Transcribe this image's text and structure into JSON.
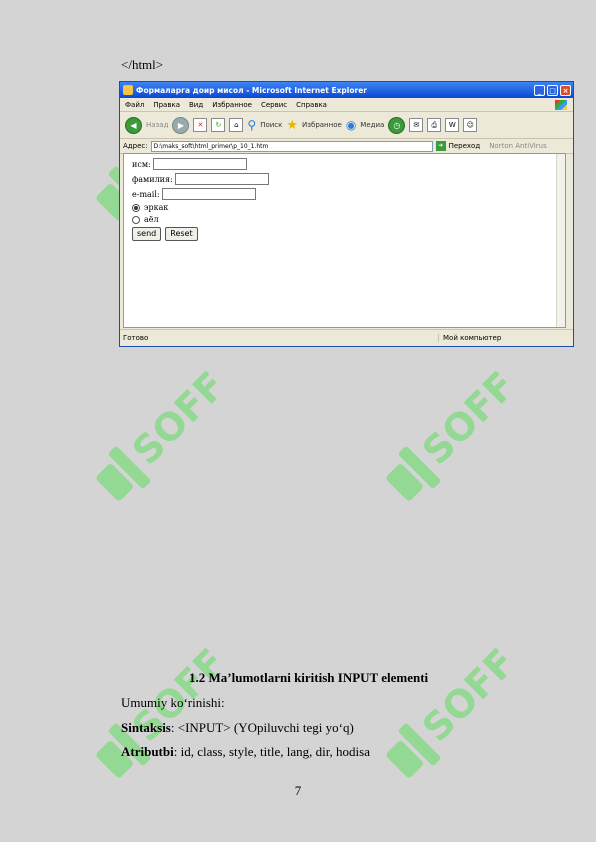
{
  "doc": {
    "closing_tag": "</html>",
    "section_title": "1.2 Ma’lumotlarni kiritish INPUT elementi",
    "general_view": "Umumiy ko‘rinishi:",
    "syntax_label": "Sintaksis",
    "syntax_text": ": <INPUT> (YOpiluvchi tegi yo‘q)",
    "attrs_label": "Atributbi",
    "attrs_text": ": id, class, style, title, lang, dir, hodisa",
    "page_number": "7"
  },
  "watermark": {
    "text": "SOFF",
    "color": "#5fdc5f"
  },
  "browser": {
    "title": "Формаларга доир мисол - Microsoft Internet Explorer",
    "menu": [
      "Файл",
      "Правка",
      "Вид",
      "Избранное",
      "Сервис",
      "Справка"
    ],
    "toolbar": {
      "back": "Назад",
      "search": "Поиск",
      "favorites": "Избранное",
      "media": "Медиа"
    },
    "address_label": "Адрес:",
    "address_value": "D:\\maks_soft\\html_primer\\p_10_1.htm",
    "go_label": "Переход",
    "antivirus_label": "Norton AntiVirus",
    "form": {
      "name_label": "исм:",
      "surname_label": "фамилия:",
      "email_label": "e-mail:",
      "radio_male": "эркак",
      "radio_female": "аёл",
      "send_label": "send",
      "reset_label": "Reset"
    },
    "status_left": "Готово",
    "status_zone": "Мой компьютер"
  }
}
